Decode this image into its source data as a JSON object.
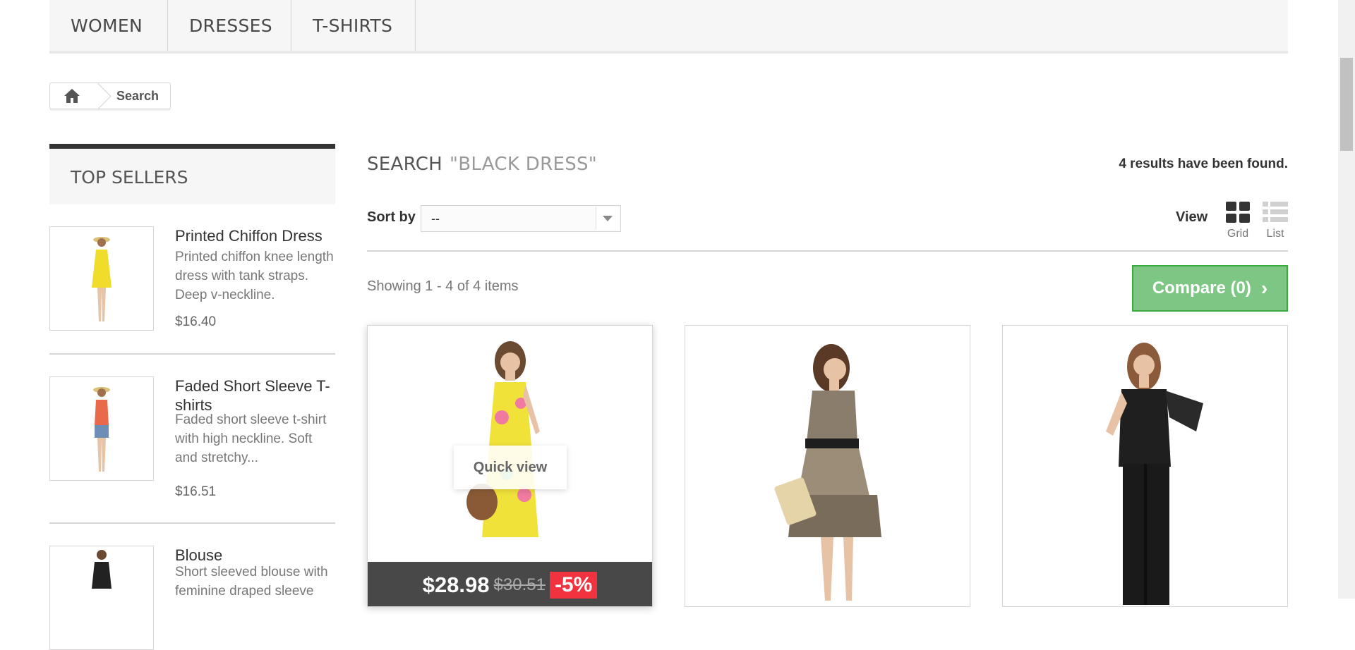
{
  "menu": {
    "items": [
      "WOMEN",
      "DRESSES",
      "T-SHIRTS"
    ]
  },
  "breadcrumb": {
    "home_icon": "home-icon",
    "current": "Search"
  },
  "top_sellers": {
    "title": "TOP SELLERS",
    "items": [
      {
        "name": "Printed Chiffon Dress",
        "description": "Printed chiffon knee length dress with tank straps. Deep v-neckline.",
        "price": "$16.40",
        "dress_color": "#f0dc2a"
      },
      {
        "name": "Faded Short Sleeve T-shirts",
        "description": "Faded short sleeve t-shirt with high neckline. Soft and stretchy...",
        "price": "$16.51",
        "dress_color": "#e96a4a"
      },
      {
        "name": "Blouse",
        "description": "Short sleeved blouse with feminine draped sleeve",
        "price": "",
        "dress_color": "#222222"
      }
    ]
  },
  "search": {
    "label": "SEARCH",
    "query": "\"BLACK DRESS\"",
    "results_text": "4 results have been found.",
    "sort_label": "Sort by",
    "sort_value": "--",
    "view_label": "View",
    "grid_label": "Grid",
    "list_label": "List",
    "showing_text": "Showing 1 - 4 of 4 items",
    "compare_label": "Compare (0)"
  },
  "products": [
    {
      "price": "$28.98",
      "old_price": "$30.51",
      "discount": "-5%",
      "quick_view": "Quick view",
      "dress_color": "#f1e23a"
    },
    {
      "price": "",
      "old_price": "",
      "discount": "",
      "quick_view": "",
      "dress_color": "#8b7d6b"
    },
    {
      "price": "",
      "old_price": "",
      "discount": "",
      "quick_view": "",
      "dress_color": "#1f1f1f"
    }
  ],
  "colors": {
    "compare_green": "#7ec683",
    "discount_red": "#f13340",
    "price_bar": "#484848"
  }
}
